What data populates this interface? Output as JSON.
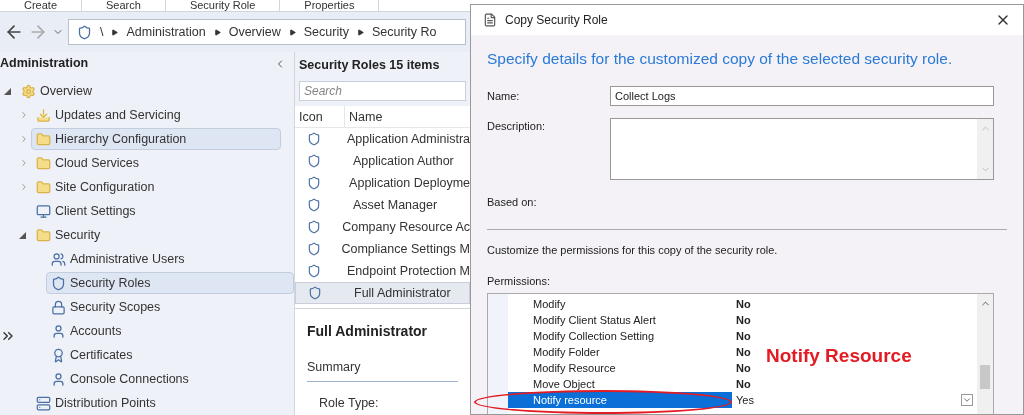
{
  "ribbon_tabs": [
    "Create",
    "Search",
    "Security Role",
    "Properties"
  ],
  "breadcrumb": [
    "\\",
    "Administration",
    "Overview",
    "Security",
    "Security Ro"
  ],
  "nav_pane": {
    "title": "Administration",
    "tree": [
      {
        "label": "Overview",
        "expanded": true,
        "selected": false,
        "children": [
          {
            "label": "Updates and Servicing",
            "expanded": false,
            "selected": false
          },
          {
            "label": "Hierarchy Configuration",
            "expanded": false,
            "selected": true
          },
          {
            "label": "Cloud Services",
            "expanded": false,
            "selected": false
          },
          {
            "label": "Site Configuration",
            "expanded": false,
            "selected": false
          },
          {
            "label": "Client Settings",
            "selected": false
          },
          {
            "label": "Security",
            "expanded": true,
            "selected": false,
            "children": [
              {
                "label": "Administrative Users",
                "selected": false
              },
              {
                "label": "Security Roles",
                "selected": true
              },
              {
                "label": "Security Scopes",
                "selected": false
              },
              {
                "label": "Accounts",
                "selected": false
              },
              {
                "label": "Certificates",
                "selected": false
              },
              {
                "label": "Console Connections",
                "selected": false
              }
            ]
          },
          {
            "label": "Distribution Points",
            "selected": false
          }
        ]
      }
    ]
  },
  "list": {
    "title": "Security Roles 15 items",
    "search_placeholder": "Search",
    "columns": [
      "Icon",
      "Name"
    ],
    "rows": [
      {
        "name": "Application Administra",
        "selected": false
      },
      {
        "name": "Application Author",
        "selected": false
      },
      {
        "name": "Application Deployme",
        "selected": false
      },
      {
        "name": "Asset Manager",
        "selected": false
      },
      {
        "name": "Company Resource Ac",
        "selected": false
      },
      {
        "name": "Compliance Settings M",
        "selected": false
      },
      {
        "name": "Endpoint Protection M",
        "selected": false
      },
      {
        "name": "Full Administrator",
        "selected": true
      }
    ]
  },
  "details": {
    "title": "Full Administrator",
    "section": "Summary",
    "fields": [
      "Role Type:"
    ]
  },
  "dialog": {
    "title": "Copy Security Role",
    "heading": "Specify details for the customized copy of the selected security role.",
    "name_label": "Name:",
    "name_value": "Collect Logs",
    "description_label": "Description:",
    "based_on_label": "Based on:",
    "instructions": "Customize the permissions for this copy of the security role.",
    "permissions_label": "Permissions:",
    "permissions": [
      {
        "name": "Modify",
        "value": "No",
        "selected": false
      },
      {
        "name": "Modify Client Status Alert",
        "value": "No",
        "selected": false
      },
      {
        "name": "Modify Collection Setting",
        "value": "No",
        "selected": false
      },
      {
        "name": "Modify Folder",
        "value": "No",
        "selected": false
      },
      {
        "name": "Modify Resource",
        "value": "No",
        "selected": false
      },
      {
        "name": "Move Object",
        "value": "No",
        "selected": false
      },
      {
        "name": "Notify resource",
        "value": "Yes",
        "selected": true
      }
    ],
    "annotation": "Notify Resource"
  }
}
